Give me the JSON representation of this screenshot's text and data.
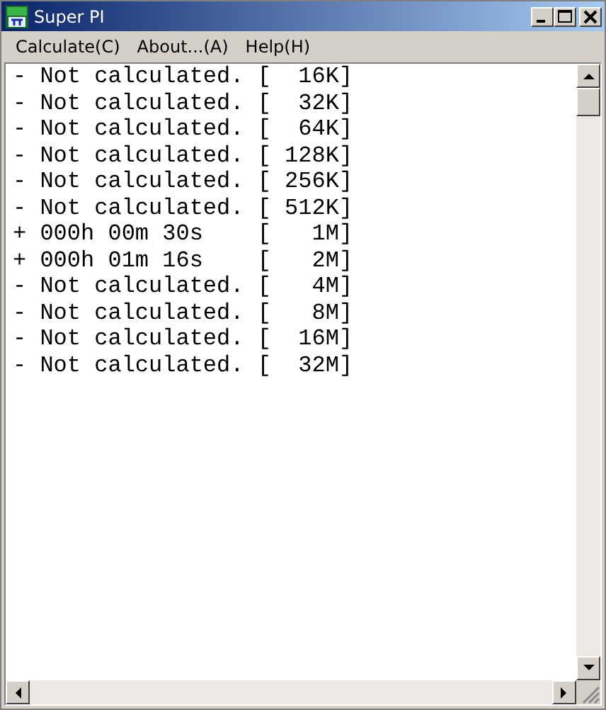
{
  "window": {
    "title": "Super PI"
  },
  "menu": [
    "Calculate(C)",
    "About...(A)",
    "Help(H)"
  ],
  "lines": [
    "- Not calculated. [  16K]",
    "- Not calculated. [  32K]",
    "- Not calculated. [  64K]",
    "- Not calculated. [ 128K]",
    "- Not calculated. [ 256K]",
    "- Not calculated. [ 512K]",
    "+ 000h 00m 30s    [   1M]",
    "+ 000h 01m 16s    [   2M]",
    "- Not calculated. [   4M]",
    "- Not calculated. [   8M]",
    "- Not calculated. [  16M]",
    "- Not calculated. [  32M]"
  ]
}
